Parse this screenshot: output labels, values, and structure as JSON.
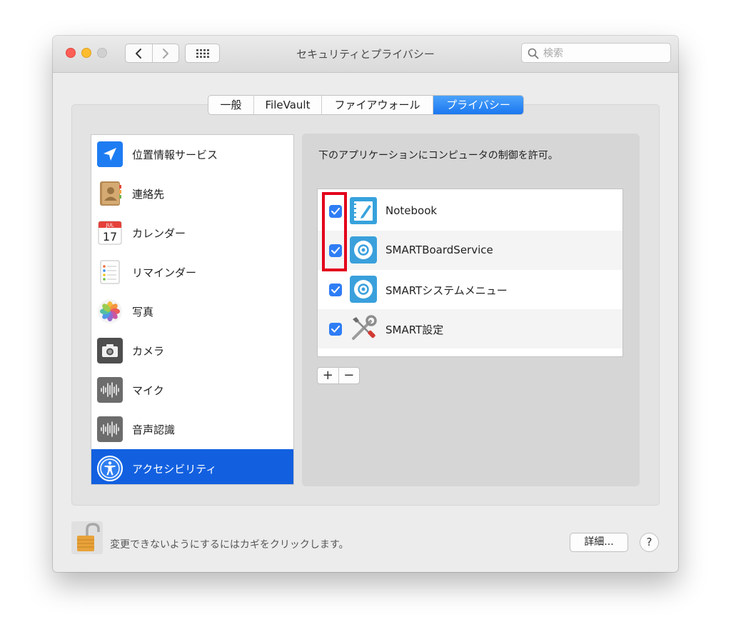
{
  "window": {
    "title": "セキュリティとプライバシー",
    "search_placeholder": "検索",
    "nav": {
      "back_icon": "chevron-left-icon",
      "forward_icon": "chevron-right-icon",
      "grid_icon": "grid-icon"
    }
  },
  "tabs": [
    {
      "label": "一般",
      "active": false
    },
    {
      "label": "FileVault",
      "active": false
    },
    {
      "label": "ファイアウォール",
      "active": false
    },
    {
      "label": "プライバシー",
      "active": true
    }
  ],
  "sidebar": {
    "items": [
      {
        "label": "位置情報サービス",
        "icon": "location-arrow-icon",
        "selected": false
      },
      {
        "label": "連絡先",
        "icon": "contacts-book-icon",
        "selected": false
      },
      {
        "label": "カレンダー",
        "icon": "calendar-icon",
        "selected": false,
        "icon_text": {
          "month": "JUL",
          "day": "17"
        }
      },
      {
        "label": "リマインダー",
        "icon": "reminders-icon",
        "selected": false
      },
      {
        "label": "写真",
        "icon": "photos-icon",
        "selected": false
      },
      {
        "label": "カメラ",
        "icon": "camera-icon",
        "selected": false
      },
      {
        "label": "マイク",
        "icon": "microphone-waveform-icon",
        "selected": false
      },
      {
        "label": "音声認識",
        "icon": "speech-waveform-icon",
        "selected": false
      },
      {
        "label": "アクセシビリティ",
        "icon": "accessibility-icon",
        "selected": true
      }
    ]
  },
  "main": {
    "instruction": "下のアプリケーションにコンピュータの制御を許可。",
    "apps": [
      {
        "name": "Notebook",
        "checked": true,
        "icon": "notebook-icon"
      },
      {
        "name": "SMARTBoardService",
        "checked": true,
        "icon": "smart-board-icon"
      },
      {
        "name": "SMARTシステムメニュー",
        "checked": true,
        "icon": "smart-system-icon"
      },
      {
        "name": "SMART設定",
        "checked": true,
        "icon": "tools-icon"
      }
    ],
    "add_label": "+",
    "remove_label": "−"
  },
  "footer": {
    "lock_text": "変更できないようにするにはカギをクリックします。",
    "advanced_label": "詳細...",
    "help_label": "?"
  },
  "colors": {
    "accent": "#1b78f0",
    "selection": "#1260e0",
    "highlight_box": "#e3001b"
  }
}
